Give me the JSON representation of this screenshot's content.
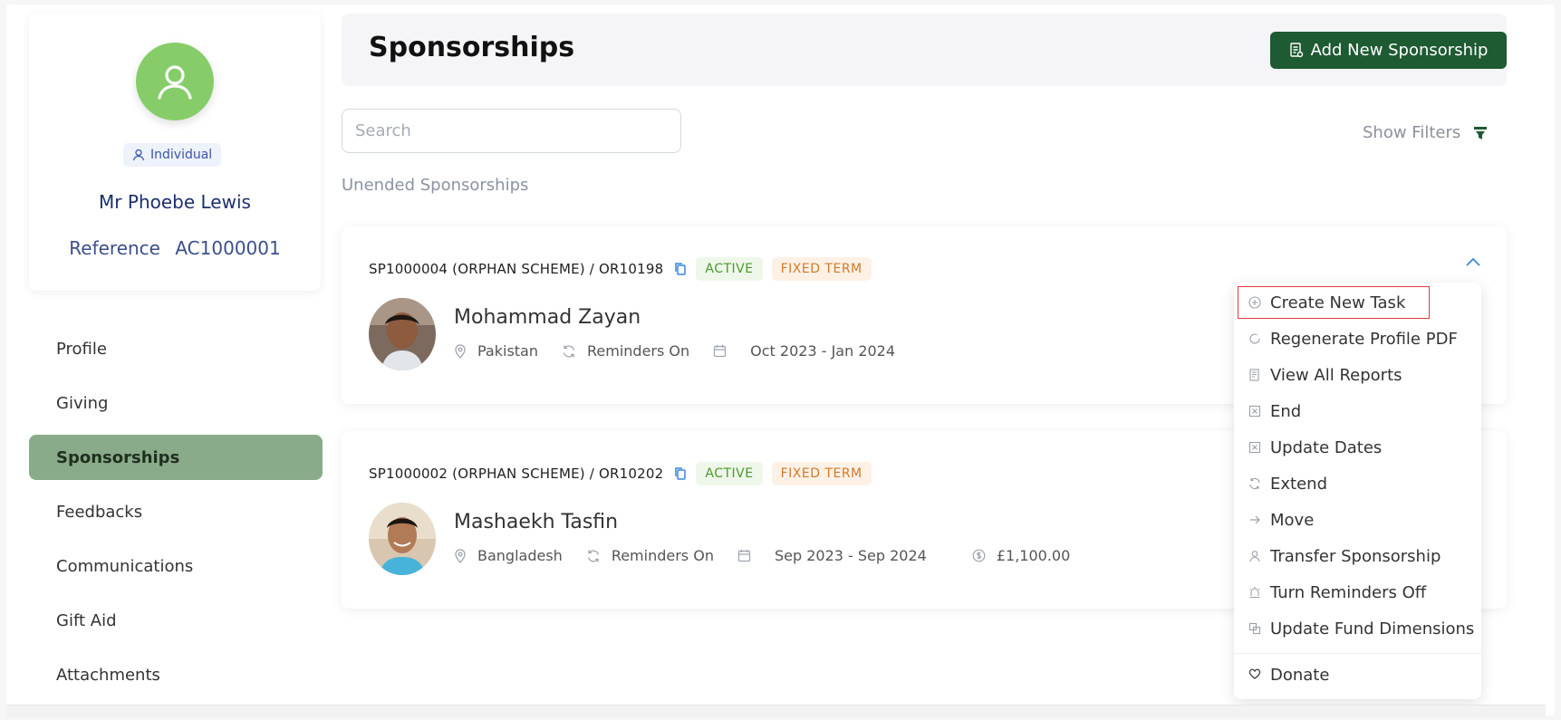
{
  "profile": {
    "type_label": "Individual",
    "name": "Mr Phoebe Lewis",
    "reference_label": "Reference",
    "reference_value": "AC1000001",
    "avatar_color": "#86cd6a"
  },
  "nav": {
    "items": [
      {
        "label": "Profile"
      },
      {
        "label": "Giving"
      },
      {
        "label": "Sponsorships",
        "active": true
      },
      {
        "label": "Feedbacks"
      },
      {
        "label": "Communications"
      },
      {
        "label": "Gift Aid"
      },
      {
        "label": "Attachments"
      }
    ]
  },
  "header": {
    "title": "Sponsorships",
    "add_button": "Add New Sponsorship"
  },
  "search": {
    "placeholder": "Search",
    "value": ""
  },
  "filters": {
    "label": "Show Filters"
  },
  "section_label": "Unended Sponsorships",
  "sponsorships": [
    {
      "id": "SP1000004 (ORPHAN SCHEME) / OR10198",
      "status": "ACTIVE",
      "term": "FIXED TERM",
      "child_name": "Mohammad Zayan",
      "country": "Pakistan",
      "reminders": "Reminders On",
      "period": "Oct 2023 - Jan 2024"
    },
    {
      "id": "SP1000002 (ORPHAN SCHEME) / OR10202",
      "status": "ACTIVE",
      "term": "FIXED TERM",
      "child_name": "Mashaekh Tasfin",
      "country": "Bangladesh",
      "reminders": "Reminders On",
      "period": "Sep 2023 - Sep 2024",
      "amount": "£1,100.00"
    }
  ],
  "menu": {
    "items": [
      {
        "label": "Create New Task",
        "icon": "plus-circle-icon",
        "focused": true
      },
      {
        "label": "Regenerate Profile PDF",
        "icon": "refresh-icon"
      },
      {
        "label": "View All Reports",
        "icon": "report-icon"
      },
      {
        "label": "End",
        "icon": "close-box-icon"
      },
      {
        "label": "Update Dates",
        "icon": "close-box-icon"
      },
      {
        "label": "Extend",
        "icon": "refresh-icon"
      },
      {
        "label": "Move",
        "icon": "arrow-right-icon"
      },
      {
        "label": "Transfer Sponsorship",
        "icon": "user-icon"
      },
      {
        "label": "Turn Reminders Off",
        "icon": "alarm-icon"
      },
      {
        "label": "Update Fund Dimensions",
        "icon": "layers-icon"
      },
      {
        "label": "Donate",
        "icon": "heart-hand-icon"
      }
    ]
  },
  "colors": {
    "primary": "#1e5a32",
    "nav_active": "#8aab8a",
    "active_green": "#4c9a2a",
    "term_orange": "#d17a2a",
    "focus_red": "#e03b3b"
  }
}
